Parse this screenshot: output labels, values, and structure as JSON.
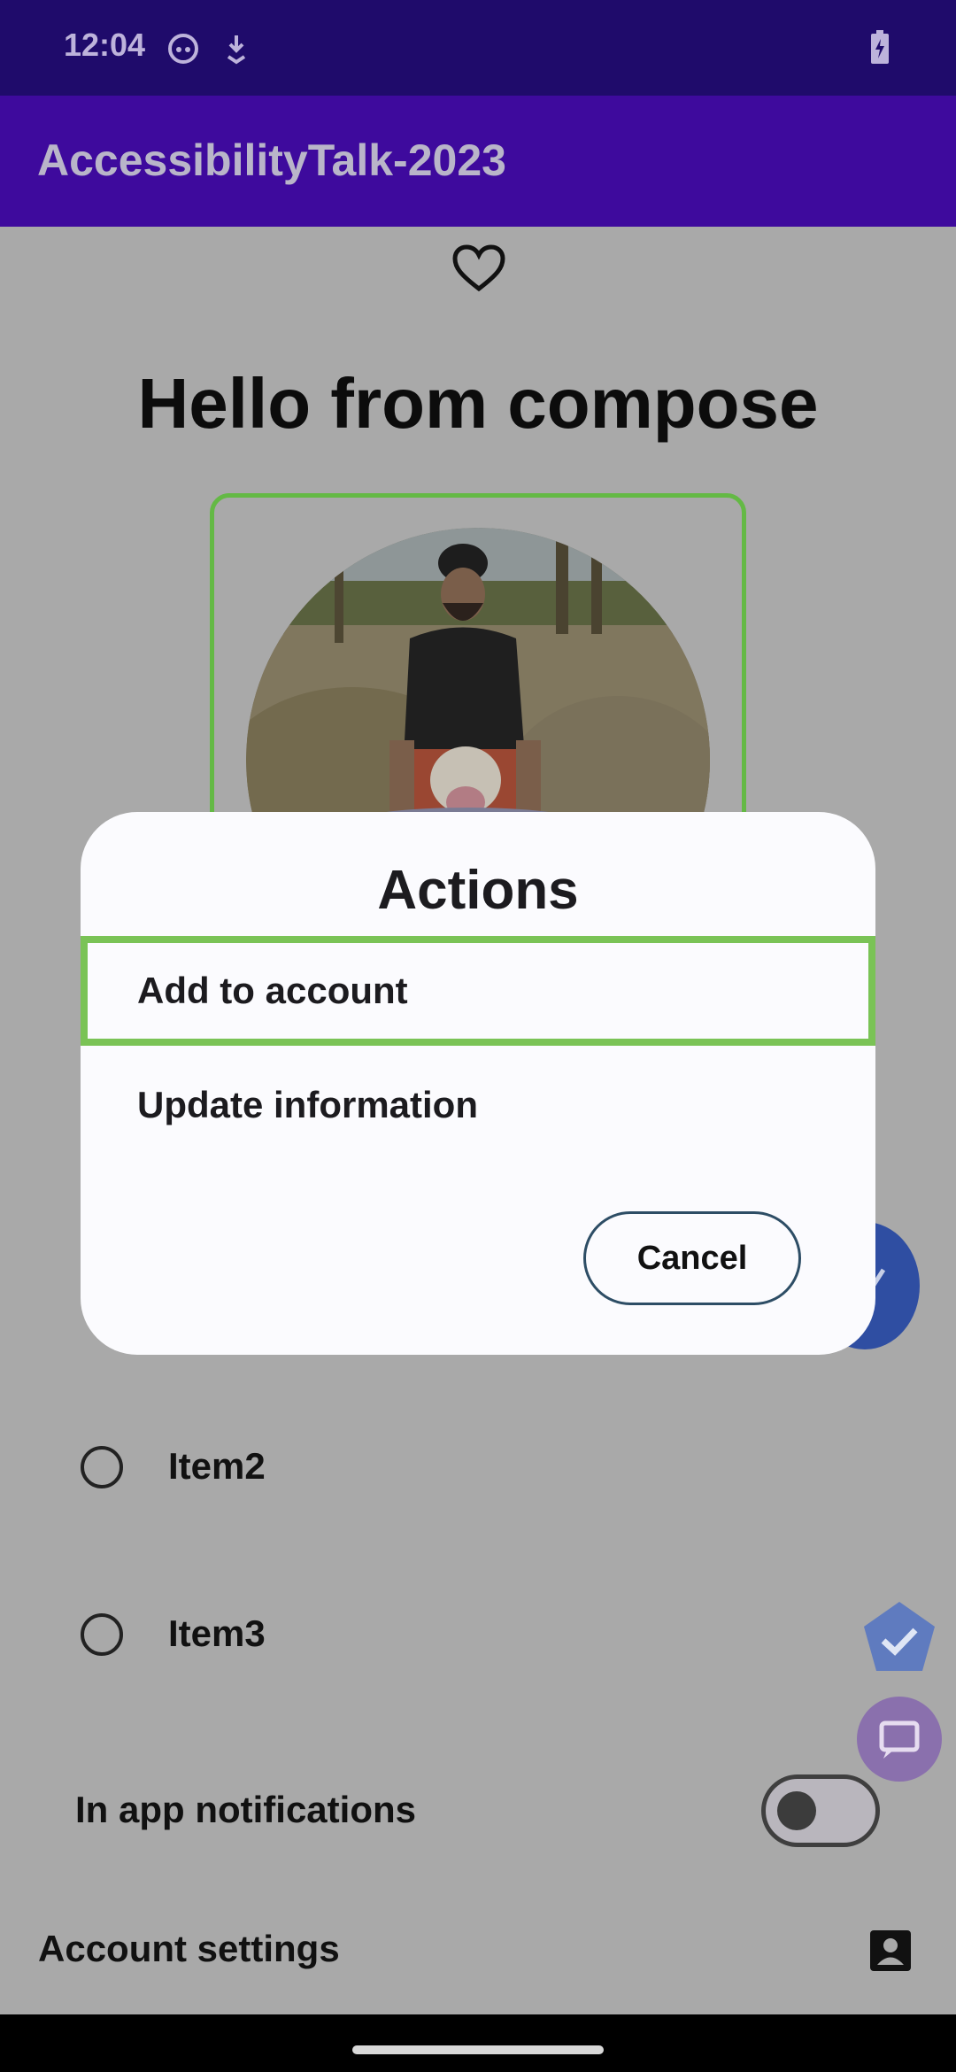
{
  "status_bar": {
    "time": "12:04",
    "icons": [
      "face-icon",
      "download-icon",
      "battery-charging-icon"
    ]
  },
  "app_bar": {
    "title": "AccessibilityTalk-2023"
  },
  "content": {
    "favorite_icon": "heart-outline-icon",
    "heading": "Hello from compose",
    "radio_items": [
      {
        "label": "Item2",
        "selected": false
      },
      {
        "label": "Item3",
        "selected": false
      }
    ],
    "notifications": {
      "label": "In app notifications",
      "enabled": false
    },
    "account": {
      "label": "Account settings",
      "icon": "account-box-icon"
    }
  },
  "dialog": {
    "title": "Actions",
    "options": [
      {
        "label": "Add to account",
        "focused": true
      },
      {
        "label": "Update information",
        "focused": false
      }
    ],
    "cancel_label": "Cancel"
  },
  "colors": {
    "status_bar": "#1f0b6b",
    "app_bar": "#3e0a9d",
    "focus_highlight": "#7ac356",
    "fab": "#2f4ea2",
    "scrim_background": "#a9a9a9"
  }
}
